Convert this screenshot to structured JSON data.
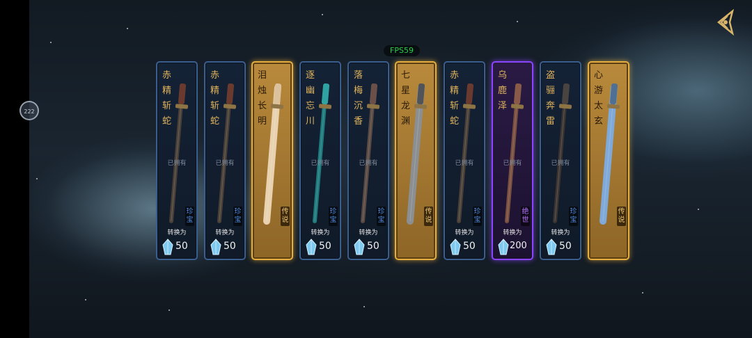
{
  "hud": {
    "fps": "FPS59",
    "menu_label": "222"
  },
  "colors": {
    "rare": "#3a5f8f",
    "legend": "#e5ae3f",
    "unique": "#8a45ff",
    "fps": "#27d04a"
  },
  "weapons": [
    {
      "name": "赤精斩蛇",
      "tier": "rare",
      "owned": "已拥有",
      "grade": "珍宝",
      "convert": "转换为",
      "cost": "50",
      "blade": "#4a4038",
      "hilt": "#6a3a2e"
    },
    {
      "name": "赤精斩蛇",
      "tier": "rare",
      "owned": "已拥有",
      "grade": "珍宝",
      "convert": "转换为",
      "cost": "50",
      "blade": "#4a4038",
      "hilt": "#6a3a2e"
    },
    {
      "name": "泪烛长明",
      "tier": "legend",
      "owned": "",
      "grade": "传说",
      "convert": "",
      "cost": "",
      "blade": "#e9d2b0",
      "hilt": "#dcc29c"
    },
    {
      "name": "逐幽忘川",
      "tier": "rare",
      "owned": "已拥有",
      "grade": "珍宝",
      "convert": "转换为",
      "cost": "50",
      "blade": "#1f7c7e",
      "hilt": "#2fa3a2"
    },
    {
      "name": "落梅沉香",
      "tier": "rare",
      "owned": "已拥有",
      "grade": "珍宝",
      "convert": "转换为",
      "cost": "50",
      "blade": "#5a4a44",
      "hilt": "#6a5048"
    },
    {
      "name": "七星龙渊",
      "tier": "legend",
      "owned": "",
      "grade": "传说",
      "convert": "",
      "cost": "",
      "blade": "#8b8f92",
      "hilt": "#505458"
    },
    {
      "name": "赤精斩蛇",
      "tier": "rare",
      "owned": "已拥有",
      "grade": "珍宝",
      "convert": "转换为",
      "cost": "50",
      "blade": "#4a4038",
      "hilt": "#6a3a2e"
    },
    {
      "name": "乌鹿泽",
      "tier": "unique",
      "owned": "已拥有",
      "grade": "绝世",
      "convert": "转换为",
      "cost": "200",
      "blade": "#7a5040",
      "hilt": "#8a5a48"
    },
    {
      "name": "盗骊奔雷",
      "tier": "rare",
      "owned": "已拥有",
      "grade": "珍宝",
      "convert": "转换为",
      "cost": "50",
      "blade": "#3b3430",
      "hilt": "#4a4440"
    },
    {
      "name": "心游太玄",
      "tier": "legend",
      "owned": "",
      "grade": "传说",
      "convert": "",
      "cost": "",
      "blade": "#7fa9d8",
      "hilt": "#4f6f93"
    }
  ]
}
